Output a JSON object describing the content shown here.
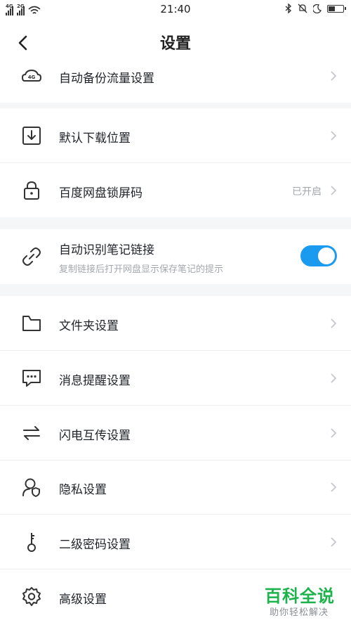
{
  "status_bar": {
    "time": "21:40",
    "net1": "4G",
    "net2": "2G"
  },
  "header": {
    "title": "设置"
  },
  "rows": {
    "backup_4g": {
      "label": "自动备份流量设置",
      "icon": "4G",
      "icon_name": "cloud-4g-icon"
    },
    "download": {
      "label": "默认下载位置",
      "icon_name": "download-icon"
    },
    "lock": {
      "label": "百度网盘锁屏码",
      "status": "已开启",
      "icon_name": "lock-icon"
    },
    "note_link": {
      "label": "自动识别笔记链接",
      "sub": "复制链接后打开网盘显示保存笔记的提示",
      "toggle_on": true,
      "icon_name": "link-icon"
    },
    "folder": {
      "label": "文件夹设置",
      "icon_name": "folder-icon"
    },
    "message": {
      "label": "消息提醒设置",
      "icon_name": "message-icon"
    },
    "transfer": {
      "label": "闪电互传设置",
      "icon_name": "transfer-arrows-icon"
    },
    "privacy": {
      "label": "隐私设置",
      "icon_name": "privacy-icon"
    },
    "password": {
      "label": "二级密码设置",
      "icon_name": "key-icon"
    },
    "advanced": {
      "label": "高级设置",
      "icon_name": "gear-icon"
    }
  },
  "watermark": {
    "title": "百科全说",
    "subtitle": "助你轻松解决"
  },
  "colors": {
    "accent": "#1a9bf0",
    "watermark": "#1db34c"
  }
}
